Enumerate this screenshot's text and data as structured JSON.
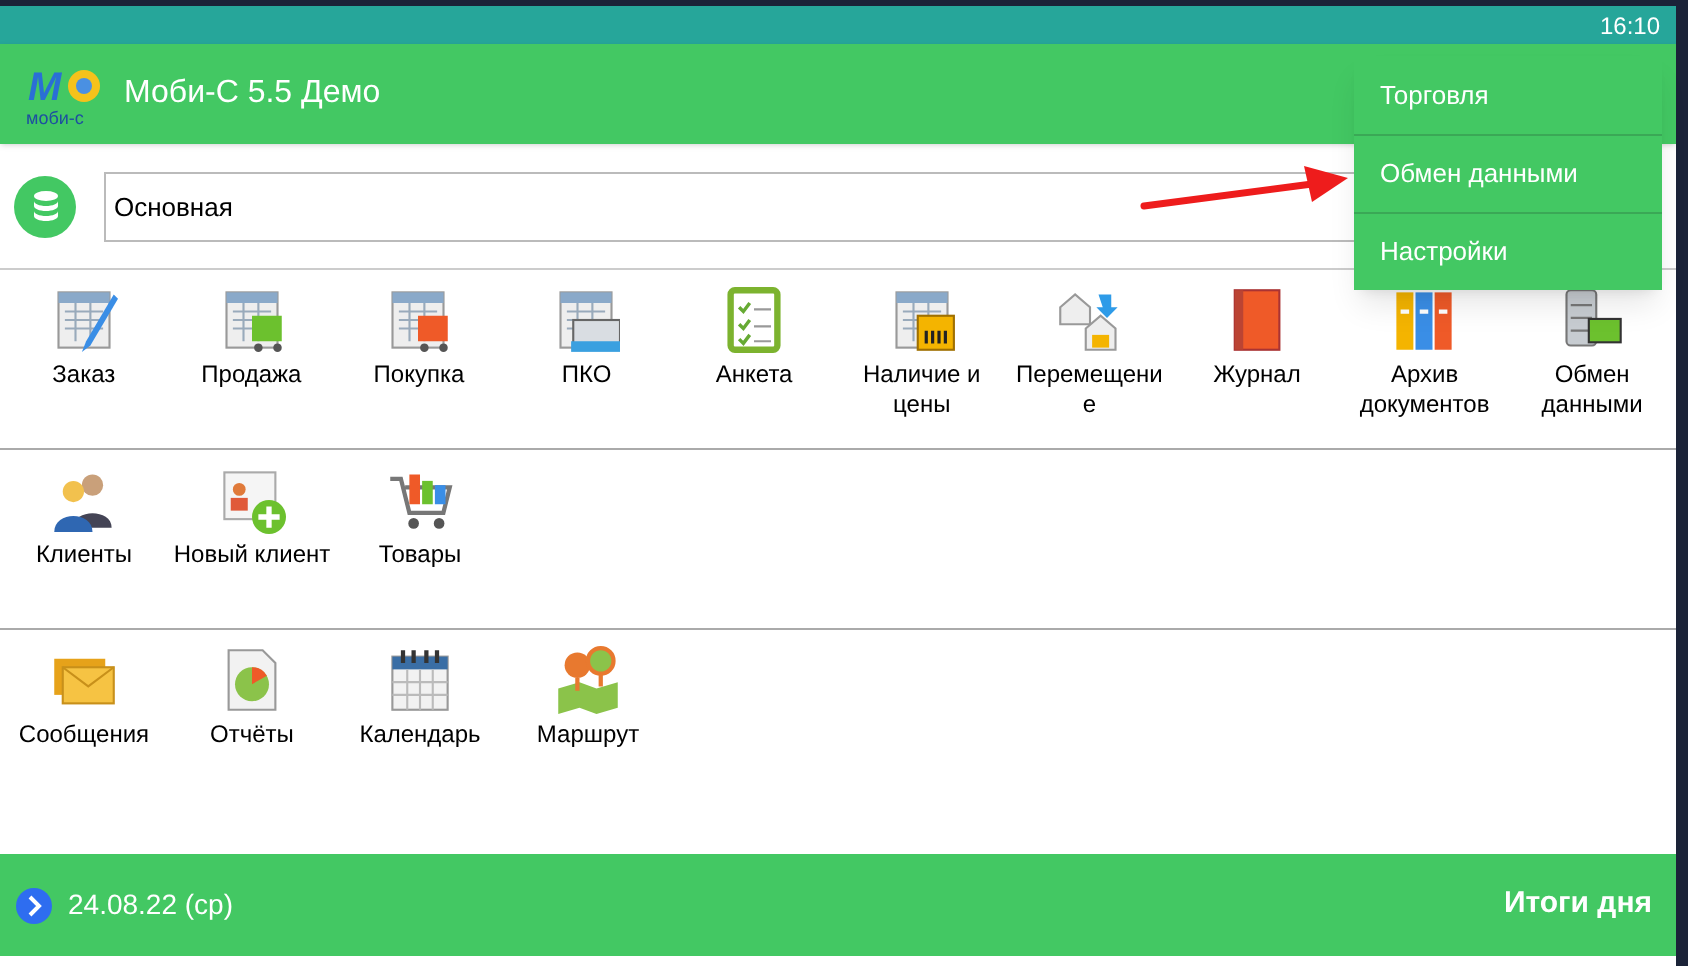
{
  "status_bar": {
    "time": "16:10"
  },
  "app_bar": {
    "logo_mark": "M",
    "logo_caption": "моби-с",
    "title": "Моби-С 5.5 Демо"
  },
  "database_field": {
    "value": "Основная"
  },
  "sections": [
    {
      "tiles": [
        {
          "label": "Заказ"
        },
        {
          "label": "Продажа"
        },
        {
          "label": "Покупка"
        },
        {
          "label": "ПКО"
        },
        {
          "label": "Анкета"
        },
        {
          "label": "Наличие и цены"
        },
        {
          "label": "Перемещени е"
        },
        {
          "label": "Журнал"
        },
        {
          "label": "Архив документов"
        },
        {
          "label": "Обмен данными"
        }
      ]
    },
    {
      "tiles": [
        {
          "label": "Клиенты"
        },
        {
          "label": "Новый клиент"
        },
        {
          "label": "Товары"
        }
      ]
    },
    {
      "tiles": [
        {
          "label": "Сообщения"
        },
        {
          "label": "Отчёты"
        },
        {
          "label": "Календарь"
        },
        {
          "label": "Маршрут"
        }
      ]
    }
  ],
  "footer": {
    "date": "24.08.22 (ср)",
    "summary_button": "Итоги дня"
  },
  "menu": {
    "items": [
      {
        "label": "Торговля"
      },
      {
        "label": "Обмен данными"
      },
      {
        "label": "Настройки"
      }
    ]
  }
}
